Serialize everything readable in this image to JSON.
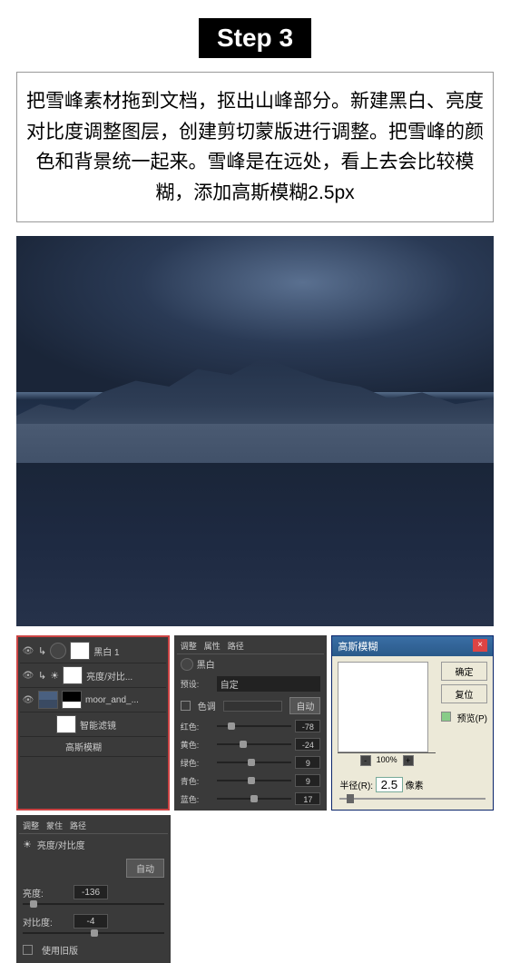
{
  "step": {
    "label": "Step 3"
  },
  "instruction": "把雪峰素材拖到文档，抠出山峰部分。新建黑白、亮度对比度调整图层，创建剪切蒙版进行调整。把雪峰的颜色和背景统一起来。雪峰是在远处，看上去会比较模糊，添加高斯模糊2.5px",
  "layers": {
    "items": [
      {
        "name": "黑白 1",
        "type": "adj"
      },
      {
        "name": "亮度/对比...",
        "type": "bright"
      },
      {
        "name": "moor_and_...",
        "type": "img"
      },
      {
        "name": "智能滤镜",
        "type": "smart"
      },
      {
        "name": "高斯模糊",
        "type": "filter"
      }
    ]
  },
  "brightness": {
    "tab1": "调整",
    "tab2": "蒙住",
    "tab3": "路径",
    "title": "亮度/对比度",
    "brightness_label": "亮度:",
    "brightness_value": "-136",
    "contrast_label": "对比度:",
    "contrast_value": "-4",
    "auto": "自动",
    "legacy": "使用旧版"
  },
  "bw": {
    "tab1": "调整",
    "tab2": "属性",
    "tab3": "路径",
    "title": "黑白",
    "preset_label": "预设:",
    "preset_value": "自定",
    "tint_label": "色调",
    "auto": "自动",
    "sliders": [
      {
        "label": "红色:",
        "value": "-78",
        "pos": 15
      },
      {
        "label": "黄色:",
        "value": "-24",
        "pos": 30
      },
      {
        "label": "绿色:",
        "value": "9",
        "pos": 42
      },
      {
        "label": "青色:",
        "value": "9",
        "pos": 42
      },
      {
        "label": "蓝色:",
        "value": "17",
        "pos": 45
      }
    ]
  },
  "dialog": {
    "title": "高斯模糊",
    "ok": "确定",
    "cancel": "复位",
    "preview": "预览(P)",
    "zoom": "100%",
    "radius_label": "半径(R):",
    "radius_value": "2.5",
    "radius_unit": "像素"
  }
}
